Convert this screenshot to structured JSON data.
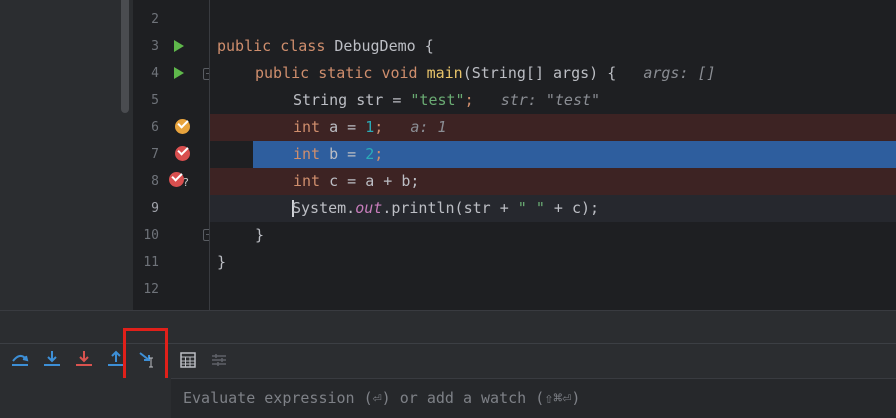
{
  "gutter": {
    "line_numbers": [
      "2",
      "3",
      "4",
      "5",
      "6",
      "7",
      "8",
      "9",
      "10",
      "11",
      "12"
    ]
  },
  "code": {
    "l3": {
      "kw1": "public",
      "kw2": "class",
      "name": " DebugDemo {"
    },
    "l4": {
      "kw1": "public",
      "kw2": "static",
      "kw3": "void",
      "fn": "main",
      "rest": "(String[] args) {",
      "hint": "args: []"
    },
    "l5": {
      "pre": "String str = ",
      "str": "\"test\"",
      "semi": ";",
      "hint": "str: \"test\""
    },
    "l6": {
      "kw": "int",
      "pre": " a = ",
      "num": "1",
      "semi": ";",
      "hint": "a: 1"
    },
    "l7": {
      "kw": "int",
      "pre": " b = ",
      "num": "2",
      "semi": ";"
    },
    "l8": {
      "kw": "int",
      "rest": " c = a + b;"
    },
    "l9": {
      "pre": "System.",
      "it": "out",
      "mid": ".println(str + ",
      "str": "\" \"",
      "post": " + c);"
    },
    "l10": {
      "text": "}"
    },
    "l11": {
      "text": "}"
    }
  },
  "breakpoint_question": "?",
  "toolbar": {
    "buttons": [
      "step-over-icon",
      "step-into-icon",
      "force-step-into-icon",
      "step-out-icon",
      "run-to-cursor-icon",
      "evaluate-expression-icon",
      "trace-icon"
    ]
  },
  "evaluate": {
    "placeholder": "Evaluate expression (⏎) or add a watch (⇧⌘⏎)"
  },
  "colors": {
    "accent_blue": "#2e5e9e",
    "highlight_red": "#e0201a",
    "icon_blue": "#3d8fd6",
    "icon_red": "#d9534f",
    "run_green": "#5fb84b"
  }
}
